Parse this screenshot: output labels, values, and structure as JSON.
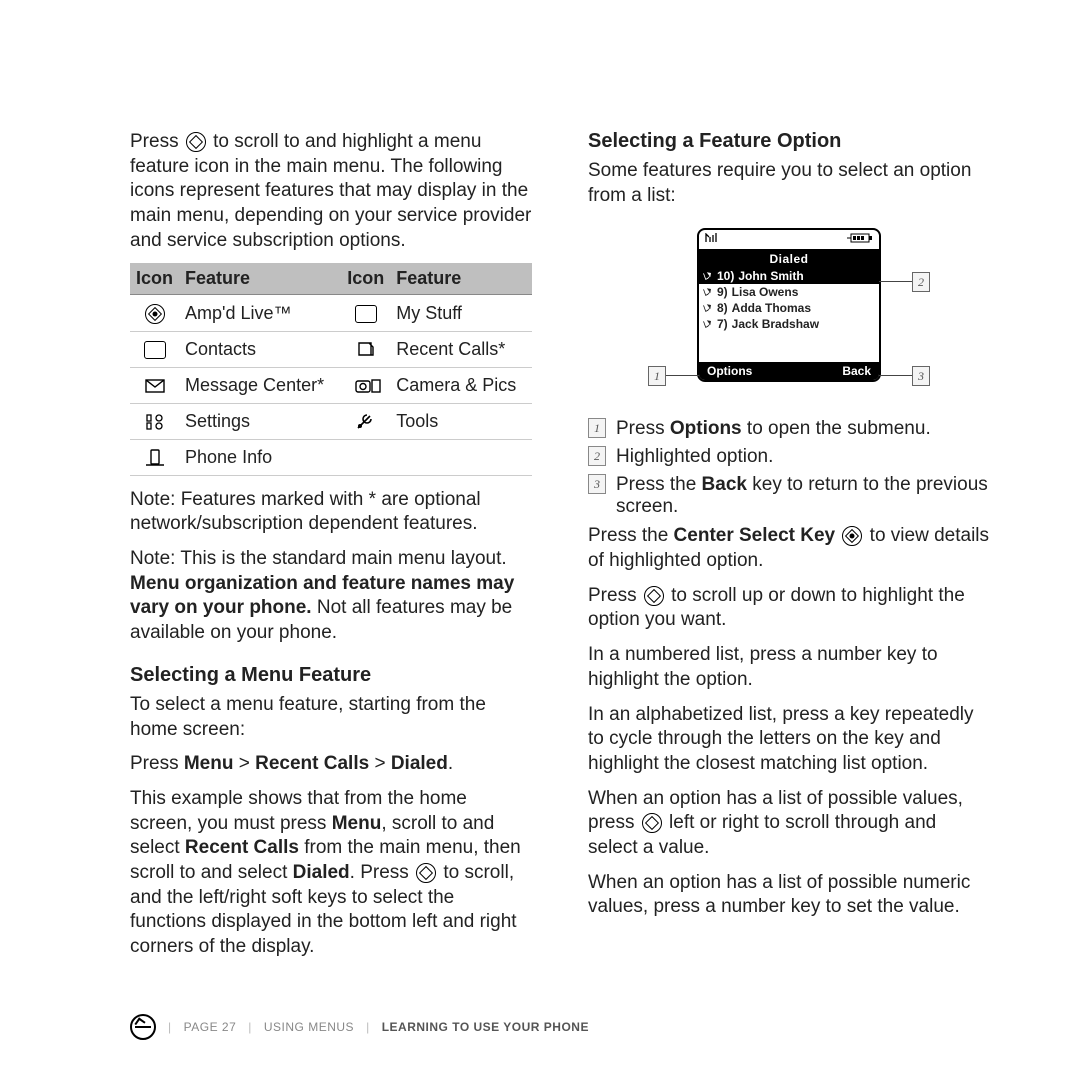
{
  "intro": "to scroll to and highlight a menu feature icon in the main menu. The following icons represent features that may display in the main menu, depending on your service provider and service subscription options.",
  "intro_prefix": "Press ",
  "table": {
    "head": [
      "Icon",
      "Feature",
      "Icon",
      "Feature"
    ],
    "rows": [
      {
        "f1": "Amp'd Live™",
        "f2": "My Stuff"
      },
      {
        "f1": "Contacts",
        "f2": "Recent Calls*"
      },
      {
        "f1": "Message Center*",
        "f2": "Camera & Pics"
      },
      {
        "f1": "Settings",
        "f2": "Tools"
      },
      {
        "f1": "Phone Info",
        "f2": ""
      }
    ]
  },
  "note_asterisk": "Note: Features marked with * are optional network/subscription dependent features.",
  "note_layout_pre": "Note: This is the standard main menu layout. ",
  "note_layout_bold": "Menu organization and feature names may vary on your phone.",
  "note_layout_post": " Not all features may be available on your phone.",
  "h_menu": "Selecting a Menu Feature",
  "menu_lead": "To select a menu feature, starting from the home screen:",
  "path_pre": "Press ",
  "path_a": "Menu",
  "path_b": "Recent Calls",
  "path_c": "Dialed",
  "gt": " > ",
  "example_1a": "This example shows that from the home screen, you must press ",
  "example_1b": "Menu",
  "example_1c": ", scroll to and select ",
  "example_1d": "Recent Calls",
  "example_1e": " from the main menu, then scroll to and select ",
  "example_1f": "Dialed",
  "example_1g": ". Press ",
  "example_2": " to scroll, and the left/right soft keys to select the functions displayed in the bottom left and right corners of the display.",
  "h_option": "Selecting a Feature Option",
  "option_lead": "Some features require you to select an option from a list:",
  "screen": {
    "title": "Dialed",
    "rows": [
      {
        "n": "10)",
        "name": "John Smith"
      },
      {
        "n": "9)",
        "name": "Lisa Owens"
      },
      {
        "n": "8)",
        "name": "Adda Thomas"
      },
      {
        "n": "7)",
        "name": "Jack Bradshaw"
      }
    ],
    "left": "Options",
    "right": "Back"
  },
  "callouts": {
    "c1": "1",
    "c2": "2",
    "c3": "3"
  },
  "legend1_a": "Press ",
  "legend1_b": "Options",
  "legend1_c": " to open the submenu.",
  "legend2": "Highlighted option.",
  "legend3_a": "Press the ",
  "legend3_b": "Back",
  "legend3_c": " key to return to the previous screen.",
  "csk_a": "Press the ",
  "csk_b": "Center Select Key",
  "csk_c": " to view details of highlighted option.",
  "scroll_a": "Press ",
  "scroll_b": " to scroll up or down to highlight the option you want.",
  "numlist": "In a numbered list, press a number key to highlight the option.",
  "alphalist": "In an alphabetized list, press a key repeatedly to cycle through the letters on the key and highlight the closest matching list option.",
  "vals_a": "When an option has a list of possible values, press ",
  "vals_b": " left or right to scroll through and select a value.",
  "numvals": "When an option has a list of possible numeric values, press a number key to set the value.",
  "footer": {
    "page": "PAGE 27",
    "sec": "USING MENUS",
    "chap": "LEARNING TO USE YOUR PHONE"
  }
}
